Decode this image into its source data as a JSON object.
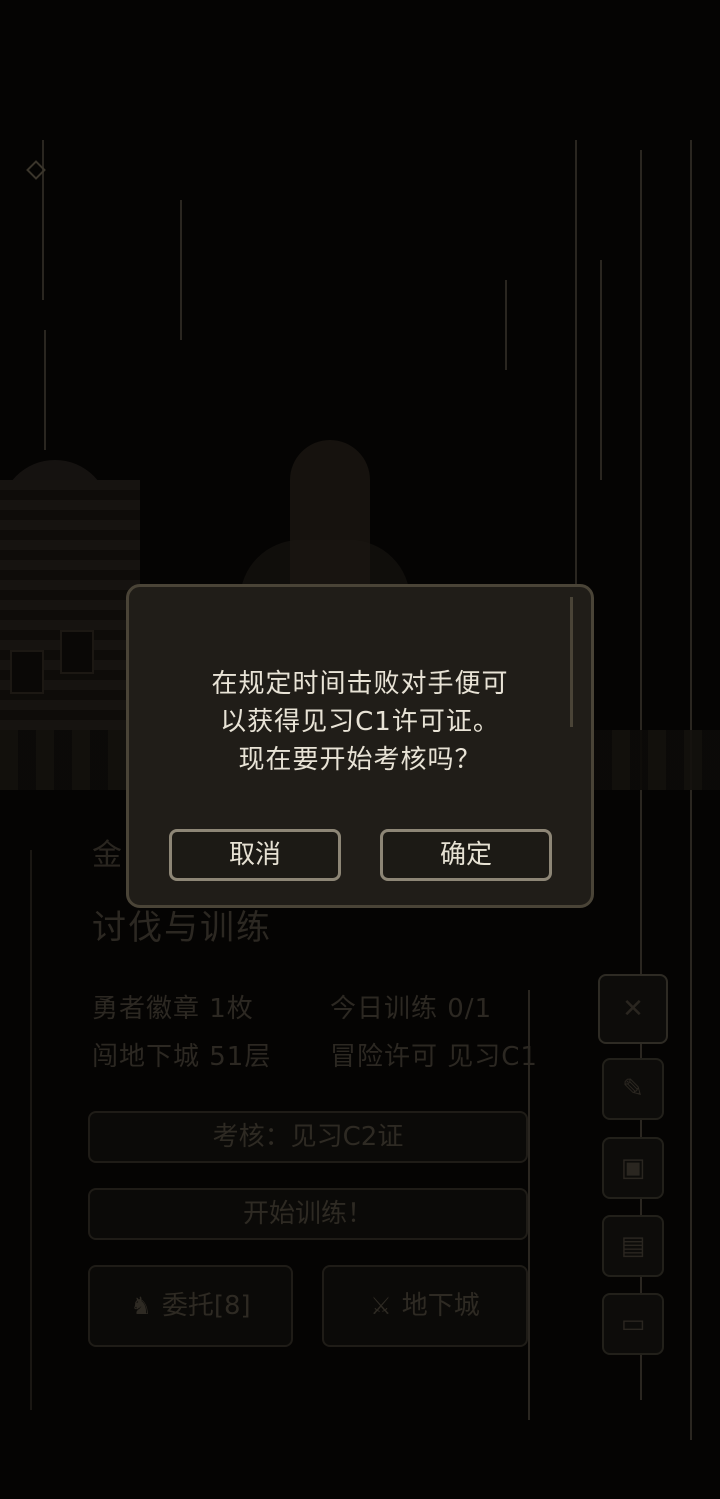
{
  "background": {
    "gold_label": "金",
    "section_title": "讨伐与训练",
    "stats": {
      "hero_badge": "勇者徽章  1枚",
      "today_training": "今日训练  0/1",
      "dungeon_floor": "闯地下城  51层",
      "adventure_license": "冒险许可  见习C1"
    },
    "exam_button": "考核：见习C2证",
    "start_training_button": "开始训练！",
    "commission_button": "委托[8]",
    "dungeon_button": "地下城",
    "side_menu": [
      {
        "icon": "swords-icon"
      },
      {
        "icon": "quill-icon"
      },
      {
        "icon": "scroll-map-icon"
      },
      {
        "icon": "document-icon"
      },
      {
        "icon": "computer-icon"
      }
    ]
  },
  "dialog": {
    "message_line1": "在规定时间击败对手便可",
    "message_line2": "以获得见习C1许可证。",
    "message_line3": "现在要开始考核吗？",
    "cancel_label": "取消",
    "confirm_label": "确定"
  }
}
